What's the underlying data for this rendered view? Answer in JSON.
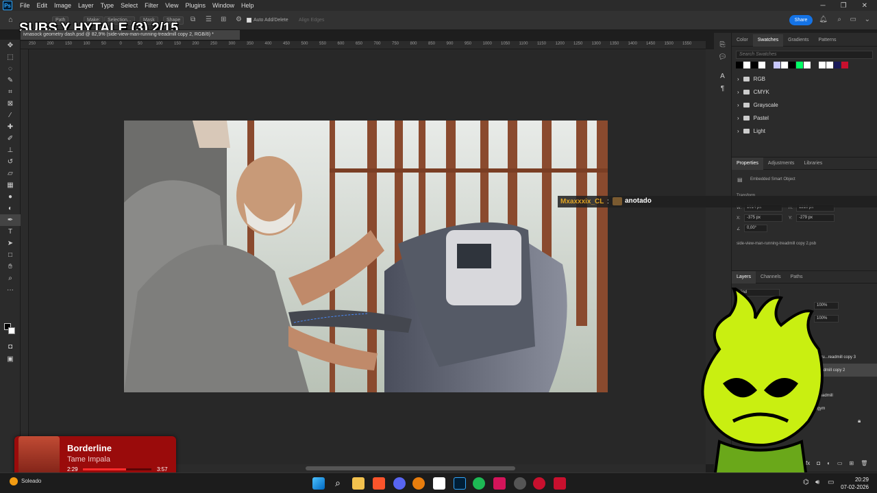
{
  "app": {
    "title": "Adobe Photoshop"
  },
  "menu": [
    "File",
    "Edit",
    "Image",
    "Layer",
    "Type",
    "Select",
    "Filter",
    "View",
    "Plugins",
    "Window",
    "Help"
  ],
  "options_bar": {
    "path_label": "Path",
    "make_label": "Make:",
    "selection_label": "Selection...",
    "mask_label": "Mask",
    "shape_label": "Shape",
    "auto_add_delete": "Auto Add/Delete",
    "align_edges": "Align Edges",
    "share": "Share"
  },
  "overlay_title": "SUBS Y HYTALE (3) 2/15",
  "document_tab": "ivnasock geometry dash.psd @ 82,9% (side-view-man-running-treadmill copy 2, RGB/8) *",
  "ruler_ticks": [
    "250",
    "200",
    "150",
    "100",
    "50",
    "0",
    "50",
    "100",
    "150",
    "200",
    "250",
    "300",
    "350",
    "400",
    "450",
    "500",
    "550",
    "600",
    "650",
    "700",
    "750",
    "800",
    "850",
    "900",
    "950",
    "1000",
    "1050",
    "1100",
    "1150",
    "1200",
    "1250",
    "1300",
    "1350",
    "1400",
    "1450",
    "1500",
    "1550"
  ],
  "swatches_panel": {
    "tabs": [
      "Color",
      "Swatches",
      "Gradients",
      "Patterns"
    ],
    "active_tab": "Swatches",
    "search_placeholder": "Search Swatches",
    "colors": [
      "#000000",
      "#ffffff",
      "#000000",
      "#ffffff",
      "#2b2b2b",
      "#c8c8ff",
      "#ffffff",
      "#000000",
      "#00ff66",
      "#ffffff",
      "#2b2b2b",
      "#ffffff",
      "#ffffff",
      "#1a1a5a",
      "#c8102e"
    ],
    "folders": [
      "RGB",
      "CMYK",
      "Grayscale",
      "Pastel",
      "Light"
    ]
  },
  "properties_panel": {
    "tabs": [
      "Properties",
      "Adjustments",
      "Libraries"
    ],
    "active_tab": "Properties",
    "type": "Embedded Smart Object",
    "transform_label": "Transform",
    "w": "1014 px",
    "h": "1210 px",
    "x": "-375 px",
    "y": "-279 px",
    "angle": "0,00°",
    "file": "side-view-man-running-treadmill copy 2.psb"
  },
  "layers_panel": {
    "tabs": [
      "Layers",
      "Channels",
      "Paths"
    ],
    "active_tab": "Layers",
    "filter": "Kind",
    "opacity": "100%",
    "fill": "100%",
    "layers": [
      "...n-ru...readmill copy 3",
      "...readmill copy 2",
      "...treadmill",
      "...gym"
    ]
  },
  "chat": {
    "user": "Mxaxxxix_CL",
    "separator": ":",
    "message": "anotado"
  },
  "music": {
    "song": "Borderline",
    "artist": "Tame Impala",
    "elapsed": "2:29",
    "duration": "3:57",
    "progress": 0.63
  },
  "taskbar": {
    "weather": "Soleado",
    "time": "20:29",
    "date": "07-02-2026"
  },
  "toolbar_icons": [
    "move-icon",
    "marquee-icon",
    "lasso-icon",
    "quick-select-icon",
    "crop-icon",
    "frame-icon",
    "eyedropper-icon",
    "healing-icon",
    "brush-icon",
    "stamp-icon",
    "history-brush-icon",
    "eraser-icon",
    "gradient-icon",
    "blur-icon",
    "dodge-icon",
    "pen-icon",
    "type-icon",
    "path-select-icon",
    "rectangle-icon",
    "hand-icon",
    "zoom-icon",
    "more-icon"
  ]
}
